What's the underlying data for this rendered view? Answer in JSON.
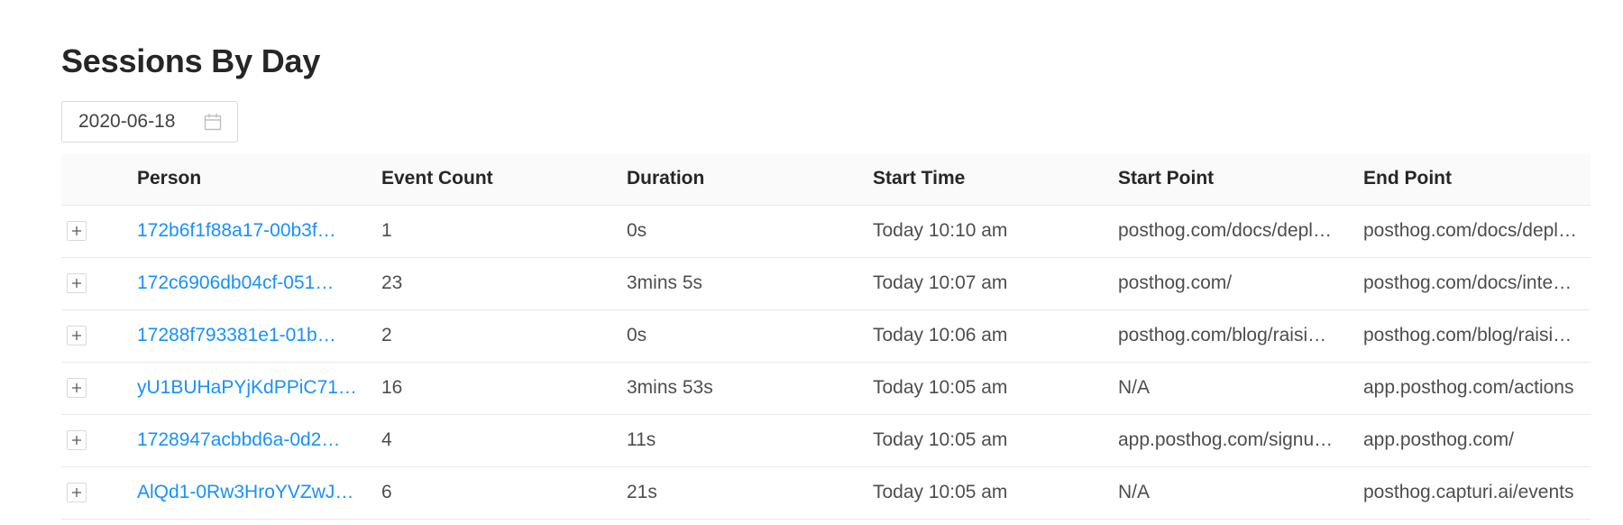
{
  "page": {
    "title": "Sessions By Day"
  },
  "date_picker": {
    "value": "2020-06-18",
    "icon": "calendar-icon"
  },
  "table": {
    "columns": [
      "Person",
      "Event Count",
      "Duration",
      "Start Time",
      "Start Point",
      "End Point"
    ],
    "rows": [
      {
        "person": "172b6f1f88a17-00b3f…",
        "event_count": "1",
        "duration": "0s",
        "start_time": "Today 10:10 am",
        "start_point": "posthog.com/docs/depl…",
        "end_point": "posthog.com/docs/depl…"
      },
      {
        "person": "172c6906db04cf-051…",
        "event_count": "23",
        "duration": "3mins 5s",
        "start_time": "Today 10:07 am",
        "start_point": "posthog.com/",
        "end_point": "posthog.com/docs/inte…"
      },
      {
        "person": "17288f793381e1-01b…",
        "event_count": "2",
        "duration": "0s",
        "start_time": "Today 10:06 am",
        "start_point": "posthog.com/blog/raisi…",
        "end_point": "posthog.com/blog/raisi…"
      },
      {
        "person": "yU1BUHaPYjKdPPiC71…",
        "event_count": "16",
        "duration": "3mins 53s",
        "start_time": "Today 10:05 am",
        "start_point": "N/A",
        "end_point": "app.posthog.com/actions"
      },
      {
        "person": "1728947acbbd6a-0d2…",
        "event_count": "4",
        "duration": "11s",
        "start_time": "Today 10:05 am",
        "start_point": "app.posthog.com/signu…",
        "end_point": "app.posthog.com/"
      },
      {
        "person": "AlQd1-0Rw3HroYVZwJ…",
        "event_count": "6",
        "duration": "21s",
        "start_time": "Today 10:05 am",
        "start_point": "N/A",
        "end_point": "posthog.capturi.ai/events"
      }
    ]
  },
  "colors": {
    "link": "#1890ff",
    "header_bg": "#fafafa",
    "border": "#e8e8e8"
  }
}
